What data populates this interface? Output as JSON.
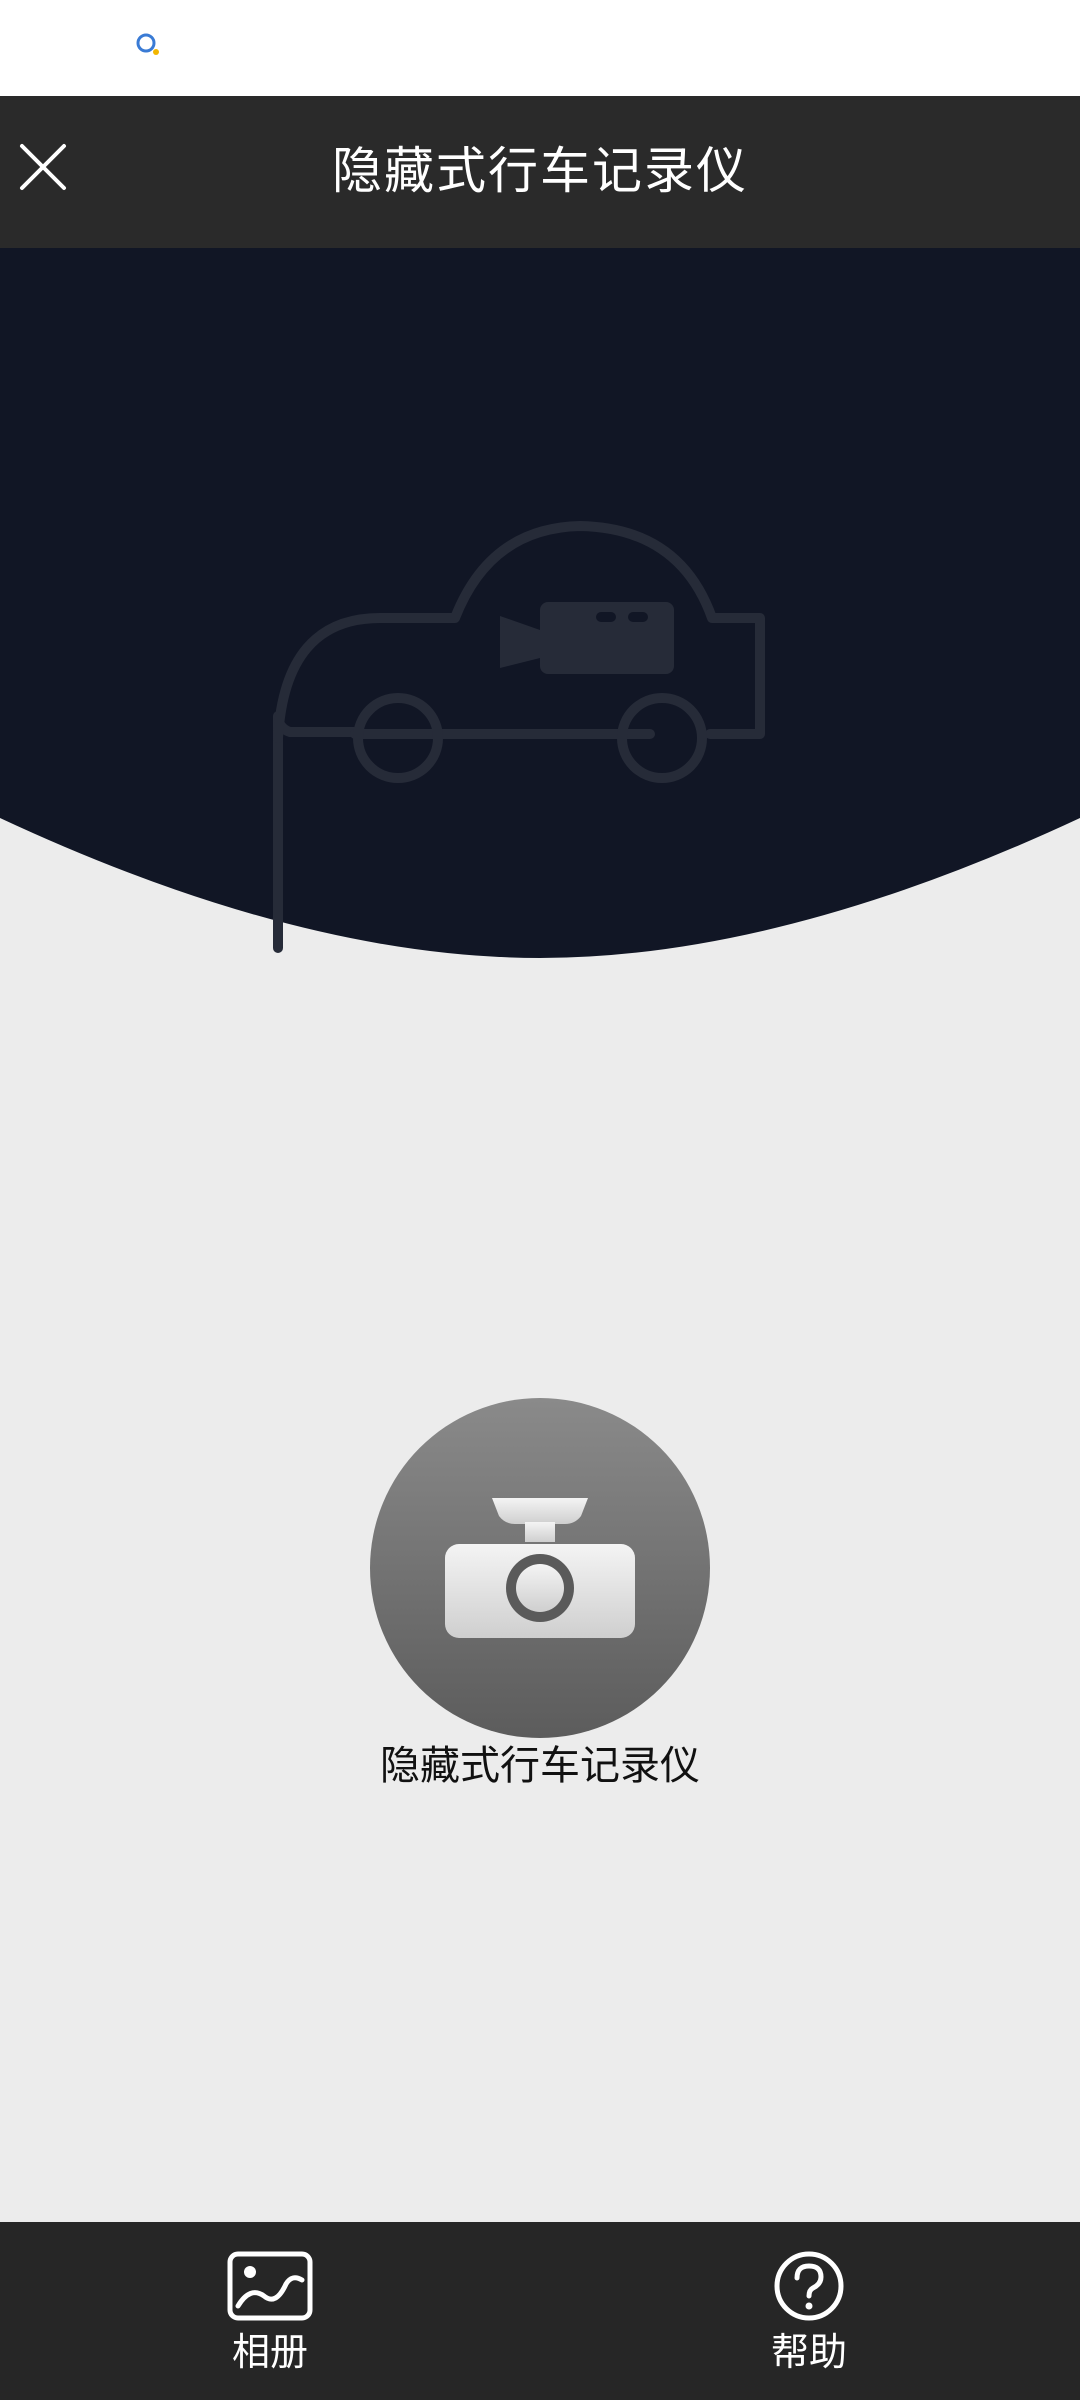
{
  "header": {
    "title": "隐藏式行车记录仪"
  },
  "device": {
    "label": "隐藏式行车记录仪"
  },
  "bottom_nav": {
    "album_label": "相册",
    "help_label": "帮助"
  },
  "colors": {
    "header_bg": "#2a2a2a",
    "hero_bg": "#111625",
    "page_bg": "#ececec",
    "bottom_bar_bg": "#262626"
  }
}
